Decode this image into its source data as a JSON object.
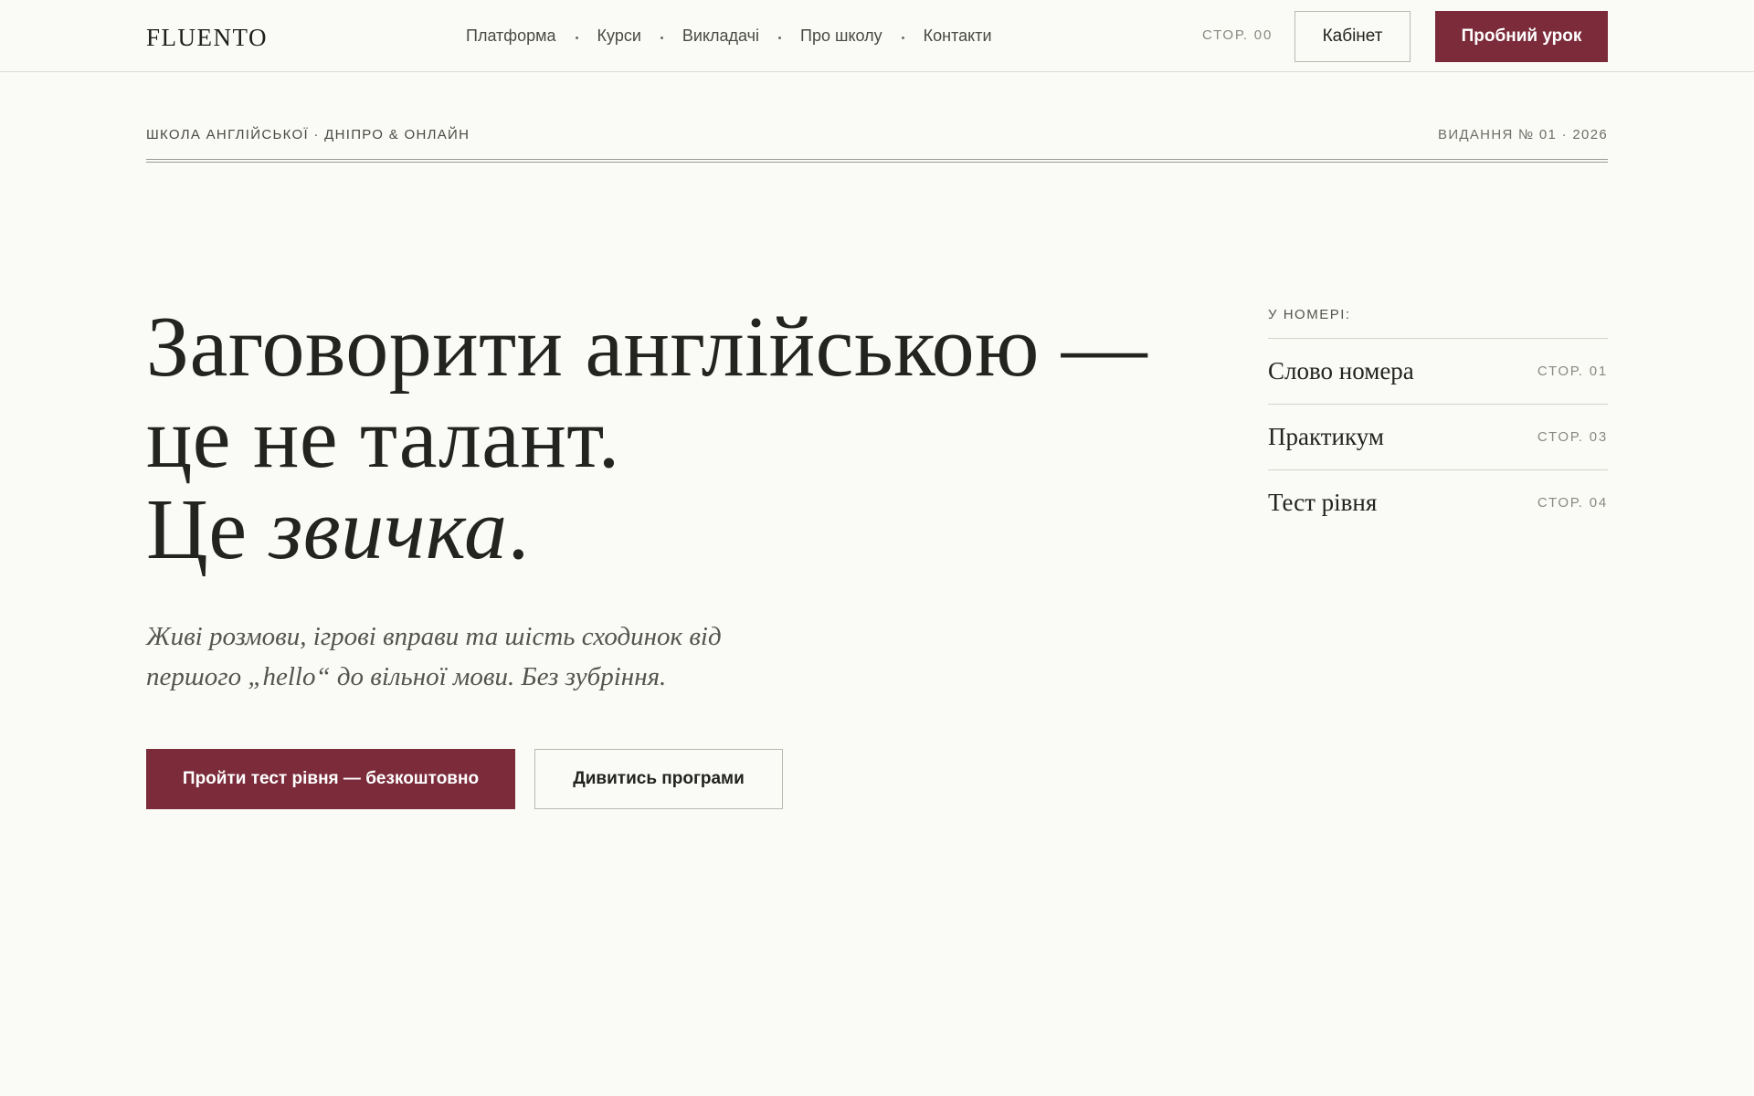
{
  "header": {
    "logo": "FLUENTO",
    "nav": [
      {
        "label": "Платформа"
      },
      {
        "label": "Курси"
      },
      {
        "label": "Викладачі"
      },
      {
        "label": "Про школу"
      },
      {
        "label": "Контакти"
      }
    ],
    "page_counter": "СТОР. 00",
    "cabinet_label": "Кабінет",
    "trial_label": "Пробний урок"
  },
  "masthead": {
    "kicker_left": "ШКОЛА АНГЛІЙСЬКОЇ · ДНІПРО & ОНЛАЙН",
    "kicker_right": "ВИДАННЯ № 01 · 2026"
  },
  "hero": {
    "title_line1": "Заговорити англійською —",
    "title_line2": "це не талант.",
    "title_line3_prefix": "Це ",
    "title_line3_emphasis": "звичка",
    "title_line3_suffix": ".",
    "subtitle": "Живі розмови, ігрові вправи та шість сходинок від першого „hello“ до вільної мови. Без зубріння.",
    "primary_cta": "Пройти тест рівня — безкоштовно",
    "secondary_cta": "Дивитись програми"
  },
  "toc": {
    "heading": "У НОМЕРІ:",
    "items": [
      {
        "title": "Слово номера",
        "page": "СТОР. 01"
      },
      {
        "title": "Практикум",
        "page": "СТОР. 03"
      },
      {
        "title": "Тест рівня",
        "page": "СТОР. 04"
      }
    ]
  },
  "colors": {
    "accent": "#7b2b3a",
    "background": "#fafaf7",
    "text": "#23231f"
  }
}
